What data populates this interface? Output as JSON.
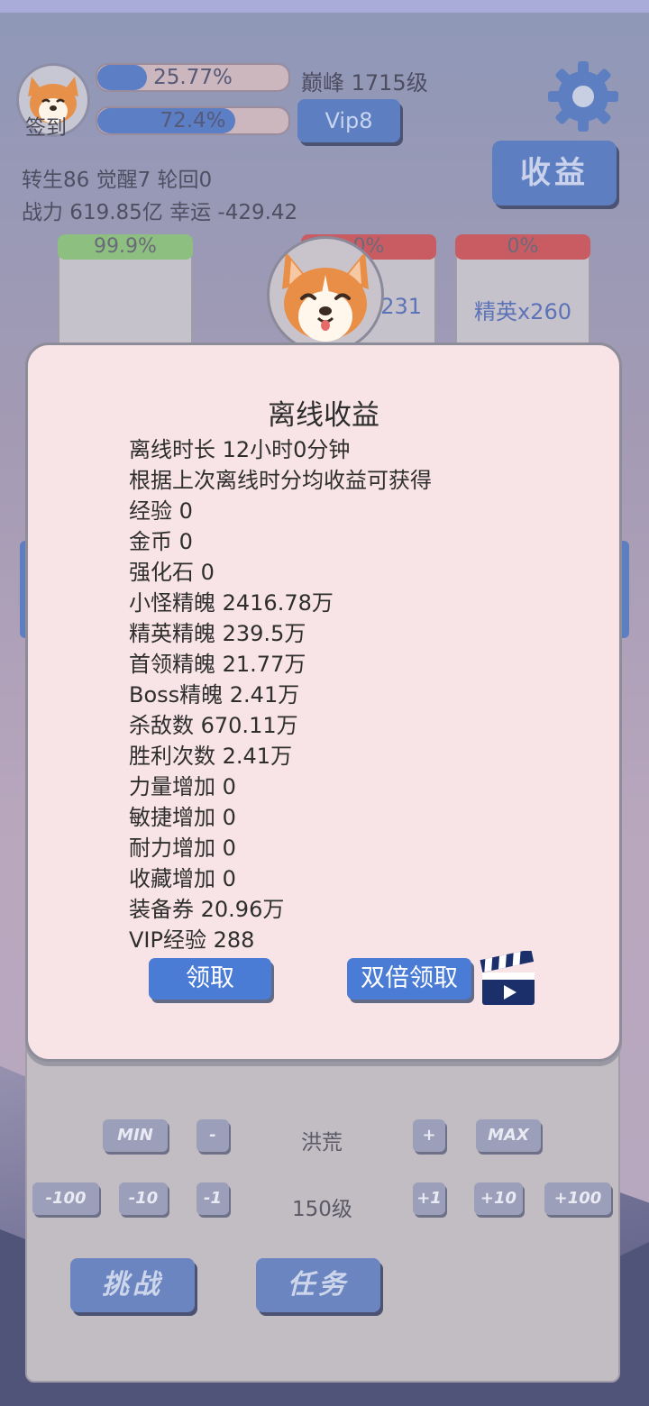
{
  "header": {
    "avatar_label": "签到",
    "exp_bar": {
      "text": "25.77%",
      "fraction": 0.2577
    },
    "second_bar": {
      "text": "72.4%",
      "fraction": 0.724
    },
    "peak_level": "巅峰 1715级",
    "vip": "Vip8",
    "income_button": "收益",
    "stats_line1": "转生86 觉醒7 轮回0",
    "stats_line2": "战力 619.85亿  幸运 -429.42"
  },
  "cards": [
    {
      "header": "99.9%",
      "label": "",
      "header_color": "#8dbf80"
    },
    {
      "header": "0%",
      "label": "x231",
      "header_color": "#c95c63"
    },
    {
      "header": "0%",
      "label": "精英x260",
      "header_color": "#c95c63"
    }
  ],
  "dialog": {
    "title": "离线收益",
    "lines": [
      "离线时长 12小时0分钟",
      "根据上次离线时分均收益可获得",
      "经验   0",
      "金币   0",
      "强化石  0",
      "小怪精魄 2416.78万",
      "精英精魄 239.5万",
      "首领精魄 21.77万",
      "Boss精魄 2.41万",
      "杀敌数  670.11万",
      "胜利次数 2.41万",
      "力量增加 0",
      "敏捷增加 0",
      "耐力增加 0",
      "收藏增加 0",
      "装备券  20.96万",
      "VIP经验 288"
    ],
    "claim_button": "领取",
    "double_claim_button": "双倍领取"
  },
  "panel": {
    "min": "MIN",
    "minus": "-",
    "region": "洪荒",
    "plus": "+",
    "max": "MAX",
    "minus100": "-100",
    "minus10": "-10",
    "minus1": "-1",
    "level": "150级",
    "plus1": "+1",
    "plus10": "+10",
    "plus100": "+100",
    "challenge": "挑战",
    "task": "任务"
  },
  "colors": {
    "accent": "#5d7fc1",
    "dialog_bg": "#f8e4e7",
    "dialog_button": "#4a7cd6"
  }
}
